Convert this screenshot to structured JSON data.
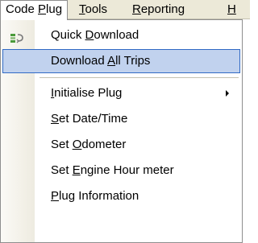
{
  "menubar": {
    "items": [
      {
        "pre": "Code ",
        "key": "P",
        "post": "lug"
      },
      {
        "pre": "",
        "key": "T",
        "post": "ools"
      },
      {
        "pre": "",
        "key": "R",
        "post": "eporting"
      },
      {
        "pre": "",
        "key": "H",
        "post": ""
      }
    ]
  },
  "dropdown": {
    "items": [
      {
        "pre": "Quick ",
        "key": "D",
        "post": "ownload",
        "icon": "quick-download-icon"
      },
      {
        "pre": "Download ",
        "key": "A",
        "post": "ll Trips"
      },
      {
        "pre": "",
        "key": "I",
        "post": "nitialise Plug"
      },
      {
        "pre": "",
        "key": "S",
        "post": "et Date/Time"
      },
      {
        "pre": "Set ",
        "key": "O",
        "post": "dometer"
      },
      {
        "pre": "Set ",
        "key": "E",
        "post": "ngine Hour meter"
      },
      {
        "pre": "",
        "key": "P",
        "post": "lug Information"
      }
    ]
  }
}
